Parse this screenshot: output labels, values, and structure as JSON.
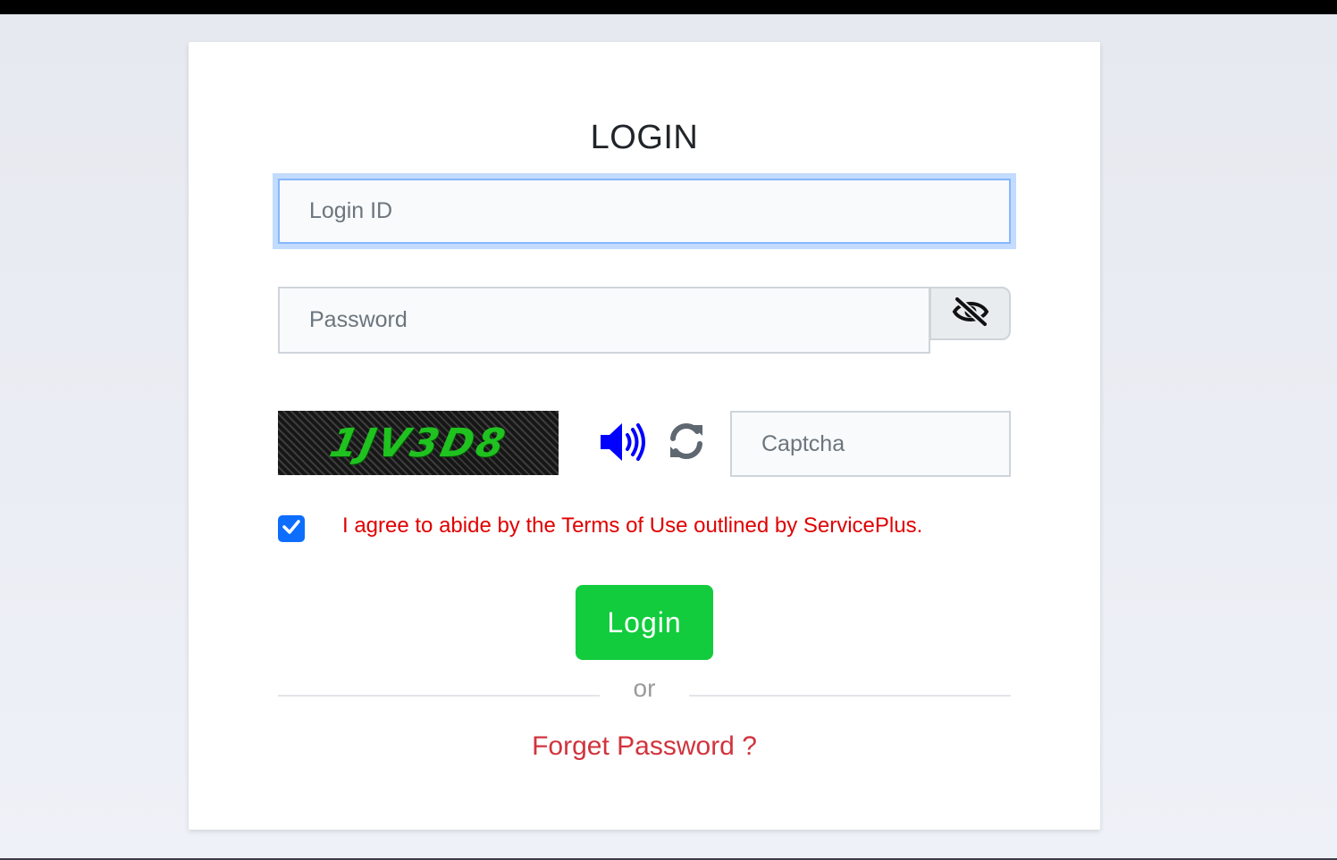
{
  "login_form": {
    "title": "LOGIN",
    "login_id_placeholder": "Login ID",
    "password_placeholder": "Password",
    "password_toggle_icon": "eye-slash-icon",
    "captcha": {
      "code": "1JV3D8",
      "code_color": "#1fc21f",
      "audio_icon": "volume-up-icon",
      "audio_icon_color": "#0000ff",
      "refresh_icon": "refresh-icon",
      "input_placeholder": "Captcha"
    },
    "terms": {
      "checked": true,
      "label": "I agree to abide by the Terms of Use outlined by ServicePlus.",
      "color": "#e00000"
    },
    "login_button_label": "Login",
    "login_button_color": "#12cc3d",
    "divider_text": "or",
    "forget_password_label": "Forget Password ?",
    "forget_password_color": "#d1343d"
  }
}
